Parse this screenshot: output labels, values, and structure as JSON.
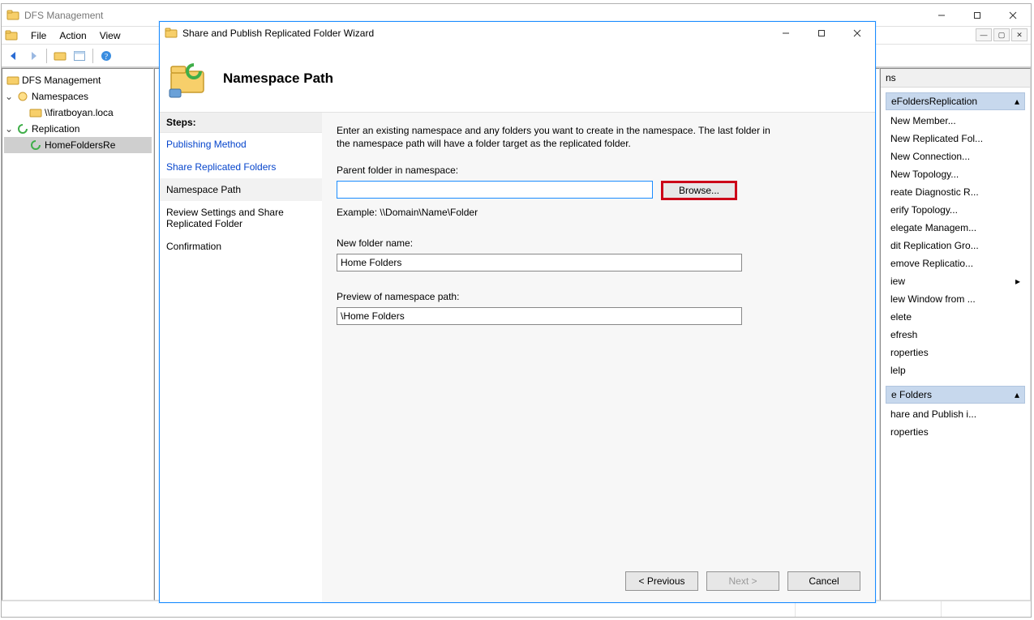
{
  "main": {
    "title": "DFS Management",
    "menus": {
      "file": "File",
      "action": "Action",
      "view": "View"
    },
    "tree": {
      "root": "DFS Management",
      "namespaces": "Namespaces",
      "namespace_item": "\\\\firatboyan.loca",
      "replication": "Replication",
      "replication_item": "HomeFoldersRe"
    },
    "actions": {
      "header": "ns",
      "group1_title": "eFoldersReplication",
      "items1": [
        "New Member...",
        "New Replicated Fol...",
        "New Connection...",
        "New Topology...",
        "reate Diagnostic R...",
        "erify Topology...",
        "elegate Managem...",
        "dit Replication Gro...",
        "emove Replicatio...",
        "iew",
        "lew Window from ...",
        "elete",
        "efresh",
        "roperties",
        "lelp"
      ],
      "group2_title": "e Folders",
      "items2": [
        "hare and Publish i...",
        "roperties"
      ]
    }
  },
  "wizard": {
    "window_title": "Share and Publish Replicated Folder Wizard",
    "page_title": "Namespace Path",
    "steps_header": "Steps:",
    "steps": {
      "publishing_method": "Publishing Method",
      "share_replicated": "Share Replicated Folders",
      "namespace_path": "Namespace Path",
      "review": "Review Settings and Share Replicated Folder",
      "confirmation": "Confirmation"
    },
    "instructions": "Enter an existing namespace and any folders you want to create in the namespace. The last folder in the namespace path will have a folder target as the replicated folder.",
    "parent_label": "Parent folder in namespace:",
    "parent_value": "",
    "browse_label": "Browse...",
    "example_label": "Example: \\\\Domain\\Name\\Folder",
    "newfolder_label": "New folder name:",
    "newfolder_value": "Home Folders",
    "preview_label": "Preview of namespace path:",
    "preview_value": "\\Home Folders",
    "buttons": {
      "previous": "< Previous",
      "next": "Next >",
      "cancel": "Cancel"
    }
  }
}
